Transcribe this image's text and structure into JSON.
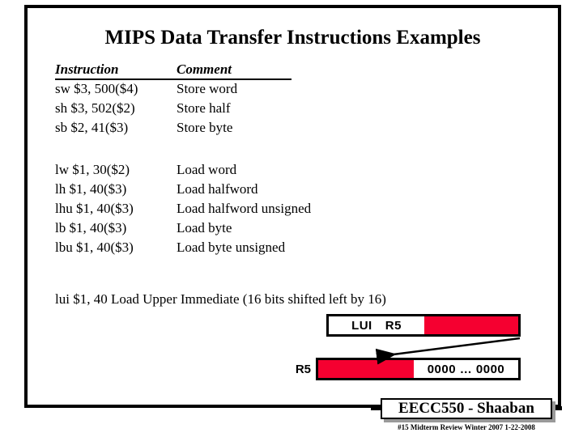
{
  "slide": {
    "title": "MIPS Data Transfer Instructions Examples",
    "border_color": "#000000",
    "background": "#ffffff"
  },
  "table": {
    "headers": {
      "instruction": "Instruction",
      "comment": "Comment"
    },
    "store_rows": [
      {
        "instruction": "sw $3, 500($4)",
        "comment": "Store word"
      },
      {
        "instruction": "sh $3, 502($2)",
        "comment": "Store half"
      },
      {
        "instruction": "sb $2, 41($3)",
        "comment": "Store byte"
      }
    ],
    "load_rows": [
      {
        "instruction": "lw $1, 30($2)",
        "comment": "Load word"
      },
      {
        "instruction": "lh  $1, 40($3)",
        "comment": "Load halfword"
      },
      {
        "instruction": "lhu  $1, 40($3)",
        "comment": "Load halfword unsigned"
      },
      {
        "instruction": "lb  $1, 40($3)",
        "comment": "Load byte"
      },
      {
        "instruction": "lbu $1, 40($3)",
        "comment": "Load byte unsigned"
      }
    ]
  },
  "lui": {
    "line": "lui $1, 40 Load Upper Immediate (16 bits shifted left by 16)"
  },
  "diagram": {
    "accent_color": "#F50030",
    "top_box": {
      "opcode_label": "LUI",
      "register_label": "R5",
      "immediate_field": ""
    },
    "bottom_box": {
      "register_label": "R5",
      "upper_field": "",
      "lower_field": "0000 … 0000"
    },
    "arrow": "shift-left-arrow"
  },
  "footer": {
    "course": "EECC550 - Shaaban",
    "subtitle": "#15   Midterm Review  Winter 2007  1-22-2008"
  }
}
